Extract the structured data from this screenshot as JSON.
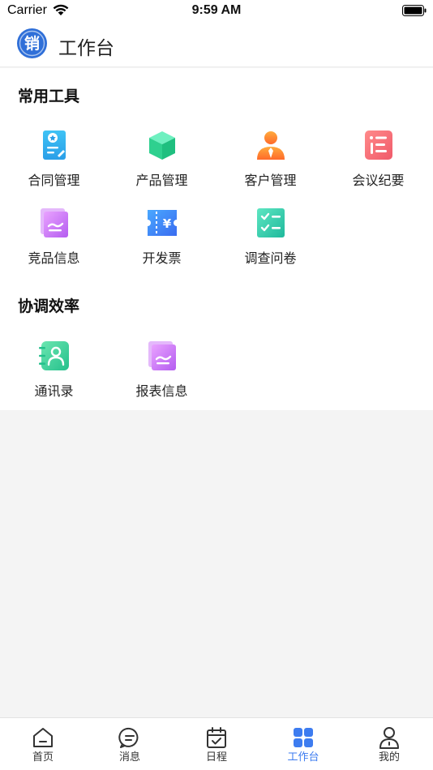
{
  "status_bar": {
    "carrier": "Carrier",
    "time": "9:59 AM"
  },
  "header": {
    "title": "工作台",
    "logo_char": "销",
    "logo_color": "#2f6fd8"
  },
  "sections": [
    {
      "title": "常用工具",
      "items": [
        {
          "label": "合同管理",
          "icon": "contract-icon"
        },
        {
          "label": "产品管理",
          "icon": "product-cube-icon"
        },
        {
          "label": "客户管理",
          "icon": "customer-icon"
        },
        {
          "label": "会议纪要",
          "icon": "meeting-notes-icon"
        },
        {
          "label": "竞品信息",
          "icon": "competitor-info-icon"
        },
        {
          "label": "开发票",
          "icon": "invoice-icon"
        },
        {
          "label": "调查问卷",
          "icon": "survey-checklist-icon"
        }
      ]
    },
    {
      "title": "协调效率",
      "items": [
        {
          "label": "通讯录",
          "icon": "contacts-icon"
        },
        {
          "label": "报表信息",
          "icon": "report-info-icon"
        }
      ]
    }
  ],
  "tabbar": {
    "active_color": "#3d7cf0",
    "tabs": [
      {
        "label": "首页",
        "icon": "home-icon",
        "active": false
      },
      {
        "label": "消息",
        "icon": "message-icon",
        "active": false
      },
      {
        "label": "日程",
        "icon": "calendar-icon",
        "active": false
      },
      {
        "label": "工作台",
        "icon": "workbench-grid-icon",
        "active": true
      },
      {
        "label": "我的",
        "icon": "profile-icon",
        "active": false
      }
    ]
  }
}
